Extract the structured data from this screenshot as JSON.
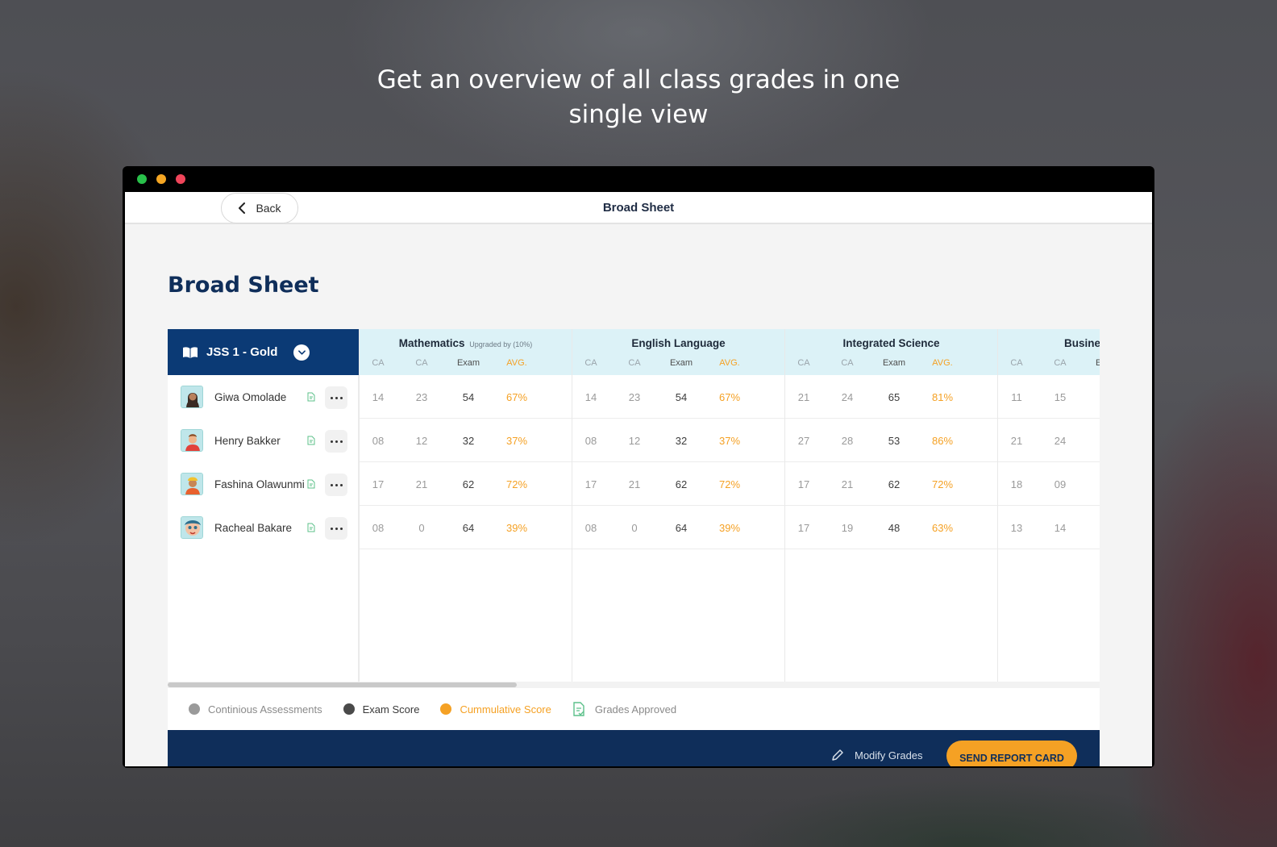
{
  "headline": {
    "line1": "Get an overview of all class grades in one",
    "line2": "single view"
  },
  "topbar": {
    "back_label": "Back",
    "title": "Broad Sheet"
  },
  "page_title": "Broad Sheet",
  "class_selector": {
    "label": "JSS 1 - Gold"
  },
  "column_labels": {
    "ca": "CA",
    "exam": "Exam",
    "avg": "AVG."
  },
  "subjects": [
    {
      "name": "Mathematics",
      "note": "Upgraded by (10%)"
    },
    {
      "name": "English Language",
      "note": ""
    },
    {
      "name": "Integrated Science",
      "note": ""
    },
    {
      "name": "Busines",
      "note": ""
    }
  ],
  "students": [
    {
      "name": "Giwa Omolade",
      "scores": [
        {
          "ca1": "14",
          "ca2": "23",
          "exam": "54",
          "avg": "67%"
        },
        {
          "ca1": "14",
          "ca2": "23",
          "exam": "54",
          "avg": "67%"
        },
        {
          "ca1": "21",
          "ca2": "24",
          "exam": "65",
          "avg": "81%"
        },
        {
          "ca1": "11",
          "ca2": "15"
        }
      ]
    },
    {
      "name": "Henry Bakker",
      "scores": [
        {
          "ca1": "08",
          "ca2": "12",
          "exam": "32",
          "avg": "37%"
        },
        {
          "ca1": "08",
          "ca2": "12",
          "exam": "32",
          "avg": "37%"
        },
        {
          "ca1": "27",
          "ca2": "28",
          "exam": "53",
          "avg": "86%"
        },
        {
          "ca1": "21",
          "ca2": "24"
        }
      ]
    },
    {
      "name": "Fashina Olawunmi",
      "scores": [
        {
          "ca1": "17",
          "ca2": "21",
          "exam": "62",
          "avg": "72%"
        },
        {
          "ca1": "17",
          "ca2": "21",
          "exam": "62",
          "avg": "72%"
        },
        {
          "ca1": "17",
          "ca2": "21",
          "exam": "62",
          "avg": "72%"
        },
        {
          "ca1": "18",
          "ca2": "09"
        }
      ]
    },
    {
      "name": "Racheal Bakare",
      "scores": [
        {
          "ca1": "08",
          "ca2": "0",
          "exam": "64",
          "avg": "39%"
        },
        {
          "ca1": "08",
          "ca2": "0",
          "exam": "64",
          "avg": "39%"
        },
        {
          "ca1": "17",
          "ca2": "19",
          "exam": "48",
          "avg": "63%"
        },
        {
          "ca1": "13",
          "ca2": "14"
        }
      ]
    }
  ],
  "legend": {
    "continuous": "Continious Assessments",
    "exam": "Exam Score",
    "cumulative": "Cummulative Score",
    "approved": "Grades Approved"
  },
  "footer": {
    "modify_label": "Modify Grades",
    "send_label": "SEND REPORT CARD"
  },
  "colors": {
    "navy": "#0f2e5a",
    "class_header": "#0b3a75",
    "subject_header_bg": "#dcf2f7",
    "accent_orange": "#f5a124",
    "approved_green": "#5cc08a",
    "ca_gray": "#9a9a9a",
    "exam_dark": "#4a4a4a"
  }
}
